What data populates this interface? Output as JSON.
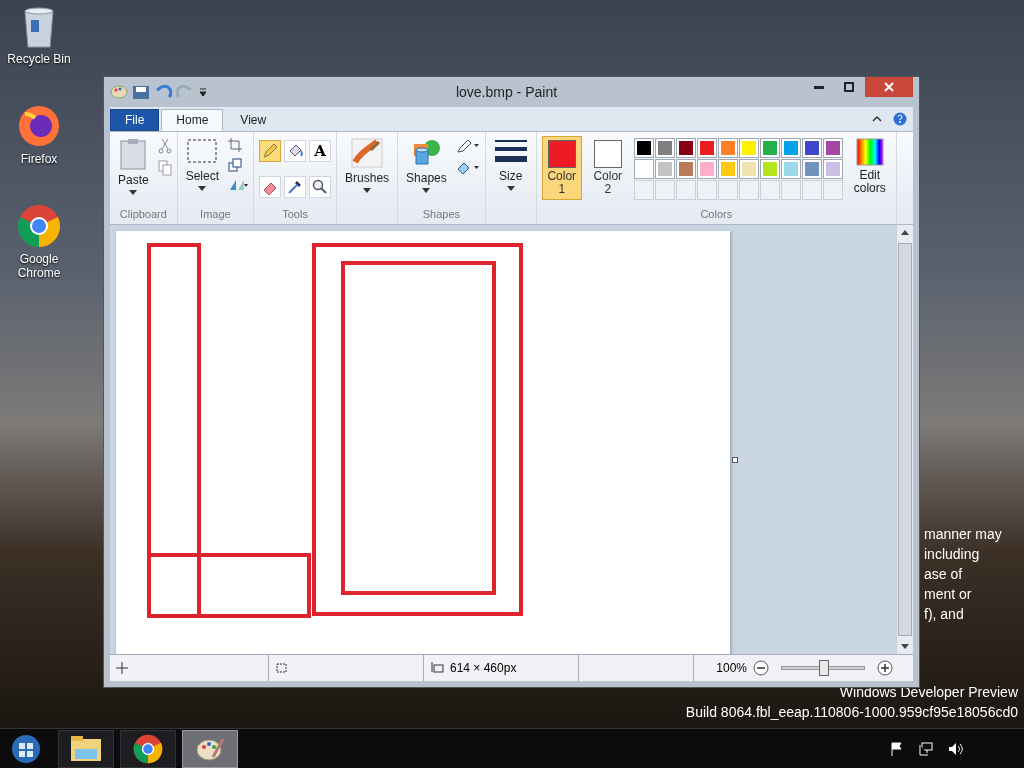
{
  "desktop": {
    "icons": [
      {
        "label": "Recycle Bin",
        "kind": "bin"
      },
      {
        "label": "Firefox",
        "kind": "firefox"
      },
      {
        "label": "Google Chrome",
        "kind": "chrome"
      }
    ],
    "background_text": [
      "manner may",
      "including",
      "ase of",
      "ment or",
      "f), and"
    ],
    "watermark": [
      "Windows Developer Preview",
      "Build 8064.fbl_eeap.110806-1000.959cf95e18056cd0"
    ]
  },
  "window": {
    "title": "love.bmp - Paint"
  },
  "tabs": [
    {
      "label": "File",
      "selected": false,
      "kind": "file"
    },
    {
      "label": "Home",
      "selected": true,
      "kind": "tab"
    },
    {
      "label": "View",
      "selected": false,
      "kind": "tab"
    }
  ],
  "ribbon": {
    "paste": "Paste",
    "clipboard": "Clipboard",
    "select": "Select",
    "image": "Image",
    "tools_label": "Tools",
    "tools": [
      {
        "kind": "pencil",
        "selected": true
      },
      {
        "kind": "fill",
        "selected": false
      },
      {
        "kind": "text",
        "label": "A",
        "selected": false
      },
      {
        "kind": "eraser",
        "selected": false
      },
      {
        "kind": "picker",
        "selected": false
      },
      {
        "kind": "magnifier",
        "selected": false
      }
    ],
    "brushes": "Brushes",
    "shapes": "Shapes",
    "shapes_label": "Shapes",
    "size": "Size",
    "colors_label": "Colors",
    "color_slots": [
      {
        "label": "Color",
        "number": "1",
        "color": "#ed1c24",
        "selected": true
      },
      {
        "label": "Color",
        "number": "2",
        "color": "#ffffff",
        "selected": false
      }
    ],
    "palette": [
      {
        "color": "#000000"
      },
      {
        "color": "#7f7f7f"
      },
      {
        "color": "#880015"
      },
      {
        "color": "#ed1c24"
      },
      {
        "color": "#ff7f27"
      },
      {
        "color": "#fff200"
      },
      {
        "color": "#22b14c"
      },
      {
        "color": "#00a2e8"
      },
      {
        "color": "#3f48cc"
      },
      {
        "color": "#a349a4"
      },
      {
        "color": "#ffffff"
      },
      {
        "color": "#c3c3c3"
      },
      {
        "color": "#b97a57"
      },
      {
        "color": "#ffaec9"
      },
      {
        "color": "#ffc90e"
      },
      {
        "color": "#efe4b0"
      },
      {
        "color": "#b5e61d"
      },
      {
        "color": "#99d9ea"
      },
      {
        "color": "#7092be"
      },
      {
        "color": "#c8bfe7"
      }
    ],
    "edit_colors": "Edit colors"
  },
  "status_bar": {
    "size": "614 × 460px",
    "zoom": "100%",
    "zoom_slider": {
      "level": 0.5
    }
  },
  "taskbar": {
    "apps": [
      {
        "kind": "explorer",
        "selected": false
      },
      {
        "kind": "chrome",
        "selected": false
      },
      {
        "kind": "paint",
        "selected": true
      }
    ]
  }
}
